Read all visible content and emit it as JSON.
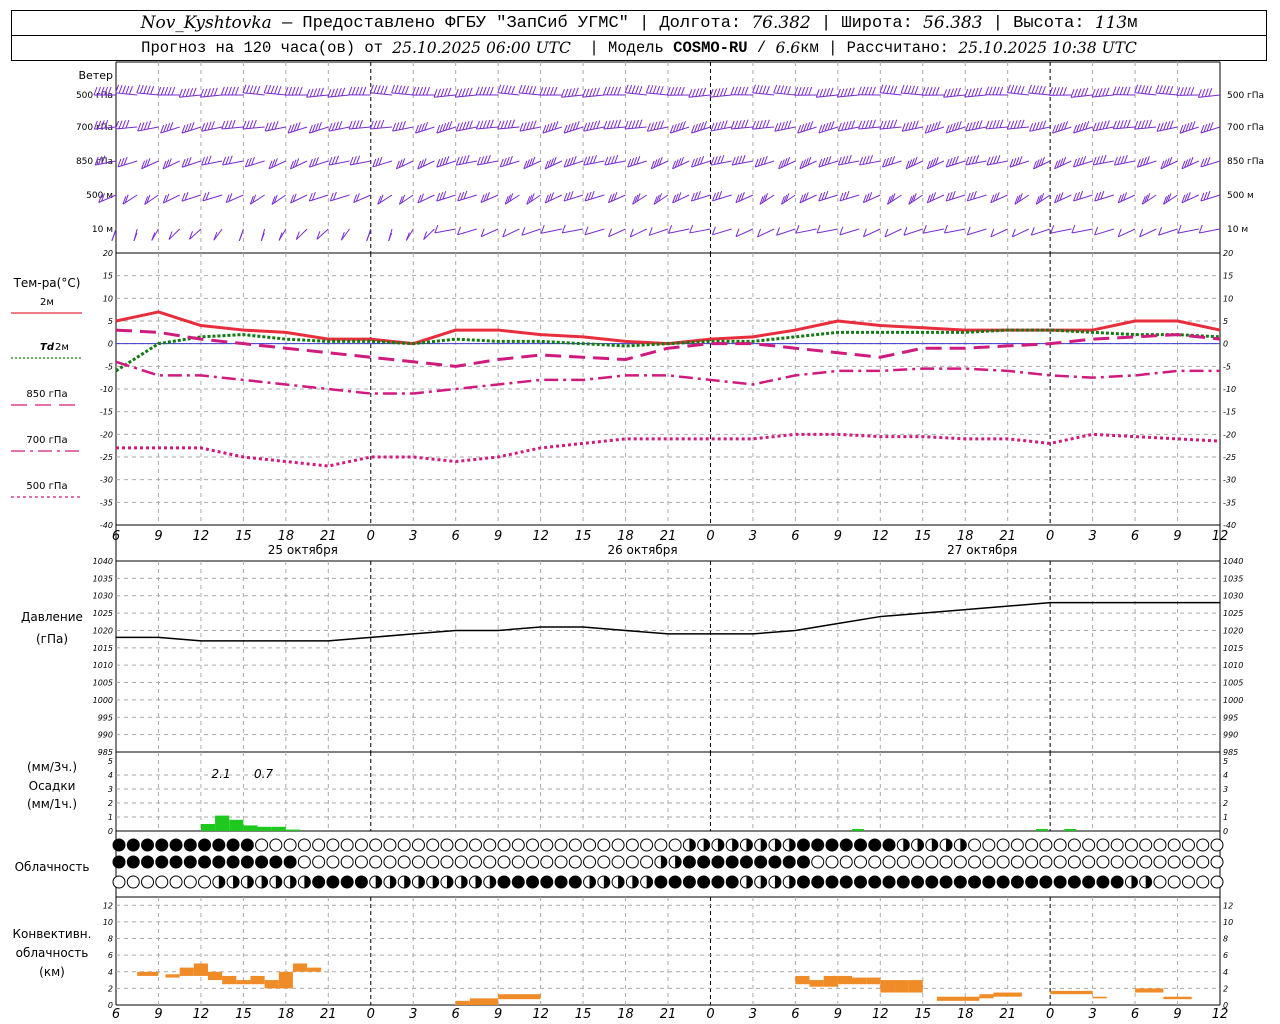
{
  "header": {
    "station": "Nov_Kyshtovka",
    "provider": "— Предоставлено ФГБУ \"ЗапСиб УГМС\"",
    "lon_label": "Долгота:",
    "lon_value": "76.382",
    "lat_label": "Широта:",
    "lat_value": "56.383",
    "alt_label": "Высота:",
    "alt_value": "113",
    "alt_unit": "м",
    "forecast_prefix": "Прогноз на 120 часа(ов) от",
    "forecast_start": "25.10.2025 06:00 UTC",
    "model_label": "Модель",
    "model_name": "COSMO-RU",
    "model_res": "6.6",
    "model_res_unit": "км",
    "calc_label": "Рассчитано:",
    "calc_time": "25.10.2025 10:38 UTC"
  },
  "panels": {
    "wind": {
      "title": "Ветер",
      "levels": [
        "500 гПа",
        "700 гПа",
        "850 гПа",
        "500 м",
        "10 м"
      ]
    },
    "temperature": {
      "title": "Тем-ра(°C)",
      "legend": [
        {
          "label": "2м",
          "color": "#e82e3c",
          "style": "solid"
        },
        {
          "label": "Td",
          "sub": "2м",
          "color": "#137a13",
          "style": "dotted"
        },
        {
          "label": "850 гПа",
          "color": "#d01a7e",
          "style": "dash"
        },
        {
          "label": "700 гПа",
          "color": "#d01a7e",
          "style": "dashdot"
        },
        {
          "label": "500 гПа",
          "color": "#d01a7e",
          "style": "dot"
        }
      ]
    },
    "pressure": {
      "title": "Давление",
      "unit": "(гПа)"
    },
    "precip": {
      "title_top": "(мм/3ч.)",
      "title": "Осадки",
      "title_bottom": "(мм/1ч.)"
    },
    "cloud": {
      "title": "Облачность"
    },
    "convective": {
      "title_1": "Конвективн.",
      "title_2": "облачность",
      "title_3": "(км)"
    }
  },
  "chart_data": [
    {
      "type": "line",
      "name": "temperature",
      "x_ticks": [
        "6",
        "9",
        "12",
        "15",
        "18",
        "21",
        "0",
        "3",
        "6",
        "9",
        "12",
        "15",
        "18",
        "21",
        "0",
        "3",
        "6",
        "9",
        "12",
        "15",
        "18",
        "21",
        "0",
        "3",
        "6",
        "9",
        "12"
      ],
      "day_labels": [
        "25 октября",
        "26 октября",
        "27 октября"
      ],
      "ylim": [
        -40,
        20
      ],
      "yticks": [
        -40,
        -35,
        -30,
        -25,
        -20,
        -15,
        -10,
        -5,
        0,
        5,
        10,
        15,
        20
      ],
      "x_hours": [
        0,
        3,
        6,
        9,
        12,
        15,
        18,
        21,
        24,
        27,
        30,
        33,
        36,
        39,
        42,
        45,
        48,
        51,
        54,
        57,
        60,
        63,
        66,
        69,
        72,
        75,
        78
      ],
      "series": [
        {
          "name": "2м",
          "values": [
            5,
            7,
            4,
            3,
            2.5,
            1,
            1,
            0,
            3,
            3,
            2,
            1.5,
            0.5,
            0,
            1,
            1.5,
            3,
            5,
            4,
            3.5,
            3,
            3,
            3,
            3,
            5,
            5,
            3
          ]
        },
        {
          "name": "Td 2м",
          "values": [
            -6,
            0,
            1.5,
            2,
            1,
            0.5,
            0.5,
            0,
            1,
            0.5,
            0.5,
            0,
            -0.5,
            0,
            0.5,
            0.5,
            1.5,
            2.5,
            2.5,
            2.5,
            2.5,
            3,
            3,
            2.5,
            2,
            2,
            1.5
          ]
        },
        {
          "name": "850 гПа",
          "values": [
            3,
            2.5,
            1,
            0,
            -1,
            -2,
            -3,
            -4,
            -5,
            -3.5,
            -2.5,
            -3,
            -3.5,
            -1,
            0,
            0,
            -1,
            -2,
            -3,
            -1,
            -1,
            -0.5,
            0,
            1,
            1.5,
            2,
            1
          ]
        },
        {
          "name": "700 гПа",
          "values": [
            -4,
            -7,
            -7,
            -8,
            -9,
            -10,
            -11,
            -11,
            -10,
            -9,
            -8,
            -8,
            -7,
            -7,
            -8,
            -9,
            -7,
            -6,
            -6,
            -5.5,
            -5.5,
            -6,
            -7,
            -7.5,
            -7,
            -6,
            -6
          ]
        },
        {
          "name": "500 гПа",
          "values": [
            -23,
            -23,
            -23,
            -25,
            -26,
            -27,
            -25,
            -25,
            -26,
            -25,
            -23,
            -22,
            -21,
            -21,
            -21,
            -21,
            -20,
            -20,
            -20.5,
            -20.5,
            -21,
            -21,
            -22,
            -20,
            -20.5,
            -21,
            -21.5
          ]
        }
      ]
    },
    {
      "type": "line",
      "name": "pressure",
      "ylim": [
        985,
        1040
      ],
      "yticks": [
        985,
        990,
        995,
        1000,
        1005,
        1010,
        1015,
        1020,
        1025,
        1030,
        1035,
        1040
      ],
      "x_hours": [
        0,
        3,
        6,
        9,
        12,
        15,
        18,
        21,
        24,
        27,
        30,
        33,
        36,
        39,
        42,
        45,
        48,
        51,
        54,
        57,
        60,
        63,
        66,
        69,
        72,
        75,
        78
      ],
      "values": [
        1018,
        1018,
        1017,
        1017,
        1017,
        1017,
        1018,
        1019,
        1020,
        1020,
        1021,
        1021,
        1020,
        1019,
        1019,
        1019,
        1020,
        1022,
        1024,
        1025,
        1026,
        1027,
        1028,
        1028,
        1028,
        1028,
        1028
      ]
    },
    {
      "type": "bar",
      "name": "precipitation",
      "ylim": [
        0,
        5
      ],
      "yticks": [
        0,
        1,
        2,
        3,
        4,
        5
      ],
      "x_hours": [
        6,
        7,
        8,
        9,
        10,
        11,
        12,
        13
      ],
      "values": [
        0.5,
        1.1,
        0.8,
        0.4,
        0.3,
        0.3,
        0.1,
        0
      ],
      "color": "#1ec81e",
      "annotations": [
        {
          "x_hour": 7,
          "text": "2.1"
        },
        {
          "x_hour": 10,
          "text": "0.7"
        }
      ]
    },
    {
      "type": "table",
      "name": "cloudiness",
      "rows": [
        {
          "name": "upper",
          "segments": [
            [
              0,
              10,
              "full"
            ],
            [
              10,
              40,
              "empty"
            ],
            [
              40,
              48,
              "half"
            ],
            [
              48,
              55,
              "full"
            ],
            [
              55,
              60,
              "half"
            ],
            [
              60,
              78,
              "empty"
            ]
          ]
        },
        {
          "name": "middle",
          "segments": [
            [
              0,
              13,
              "full"
            ],
            [
              13,
              38,
              "empty"
            ],
            [
              38,
              40,
              "half"
            ],
            [
              40,
              49,
              "full"
            ],
            [
              49,
              78,
              "empty"
            ]
          ]
        },
        {
          "name": "lower",
          "segments": [
            [
              0,
              7,
              "empty"
            ],
            [
              7,
              14,
              "half"
            ],
            [
              14,
              18,
              "full"
            ],
            [
              18,
              27,
              "half"
            ],
            [
              27,
              33,
              "full"
            ],
            [
              33,
              38,
              "half"
            ],
            [
              38,
              44,
              "full"
            ],
            [
              44,
              48,
              "half"
            ],
            [
              48,
              71,
              "full"
            ],
            [
              71,
              73,
              "half"
            ],
            [
              73,
              78,
              "empty"
            ]
          ]
        }
      ]
    },
    {
      "type": "bar",
      "name": "convective",
      "ylim": [
        0,
        13
      ],
      "yticks": [
        0,
        2,
        4,
        6,
        8,
        10,
        12
      ],
      "bars": [
        [
          1.5,
          3,
          3.5,
          4
        ],
        [
          3.5,
          4.5,
          3.3,
          3.7
        ],
        [
          4.5,
          5.5,
          3.5,
          4.5
        ],
        [
          5.5,
          6.5,
          3.5,
          5
        ],
        [
          6.5,
          7.5,
          3,
          4
        ],
        [
          7.5,
          8.5,
          2.5,
          3.5
        ],
        [
          8.5,
          9.5,
          2.5,
          3
        ],
        [
          9.5,
          10.5,
          2.5,
          3.5
        ],
        [
          10.5,
          11.5,
          2,
          3
        ],
        [
          11.5,
          12.5,
          2,
          4
        ],
        [
          12.5,
          13.5,
          4,
          5
        ],
        [
          13.5,
          14.5,
          4,
          4.5
        ],
        [
          24,
          25,
          0,
          0.5
        ],
        [
          25,
          27,
          0,
          0.8
        ],
        [
          27,
          30,
          0.7,
          1.3
        ],
        [
          48,
          49,
          2.5,
          3.5
        ],
        [
          49,
          50,
          2.2,
          3
        ],
        [
          50,
          51,
          2.2,
          3.5
        ],
        [
          51,
          52,
          2.5,
          3.5
        ],
        [
          52,
          53,
          2.5,
          3.3
        ],
        [
          53,
          54,
          2.5,
          3.3
        ],
        [
          54,
          55,
          1.5,
          3
        ],
        [
          55,
          56,
          1.5,
          3
        ],
        [
          56,
          57,
          1.5,
          3
        ],
        [
          58,
          61,
          0.5,
          1
        ],
        [
          61,
          62,
          0.8,
          1.3
        ],
        [
          62,
          64,
          1,
          1.5
        ],
        [
          66,
          69,
          1.3,
          1.7
        ],
        [
          69,
          70,
          0.8,
          1
        ],
        [
          72,
          74,
          1.5,
          2
        ],
        [
          74,
          76,
          0.7,
          1
        ]
      ],
      "color": "#f08c28"
    },
    {
      "type": "scatter",
      "name": "wind",
      "levels": [
        "500 гПа",
        "700 гПа",
        "850 гПа",
        "500 м",
        "10 м"
      ],
      "x_hours": [
        0,
        3,
        6,
        9,
        12,
        15,
        18,
        21,
        24,
        27,
        30,
        33,
        36,
        39,
        42,
        45,
        48,
        51,
        54,
        57,
        60,
        63,
        66,
        69,
        72,
        75,
        78
      ],
      "speed_ms": [
        [
          25,
          25,
          25,
          25,
          25,
          25,
          25,
          25,
          25,
          25,
          25,
          25,
          25,
          25,
          25,
          25,
          25,
          25,
          25,
          25,
          25,
          25,
          25,
          25,
          25,
          25,
          20
        ],
        [
          20,
          20,
          20,
          20,
          20,
          20,
          20,
          20,
          25,
          25,
          25,
          25,
          25,
          25,
          25,
          25,
          25,
          25,
          25,
          25,
          25,
          25,
          25,
          25,
          25,
          25,
          20
        ],
        [
          15,
          15,
          15,
          15,
          15,
          15,
          15,
          15,
          20,
          20,
          20,
          20,
          20,
          20,
          20,
          20,
          20,
          20,
          20,
          20,
          20,
          20,
          20,
          20,
          20,
          20,
          15
        ],
        [
          10,
          10,
          10,
          10,
          10,
          10,
          10,
          10,
          15,
          15,
          15,
          15,
          15,
          15,
          15,
          15,
          15,
          15,
          15,
          15,
          15,
          15,
          15,
          15,
          15,
          15,
          15
        ],
        [
          3,
          3,
          3,
          3,
          3,
          3,
          3,
          3,
          5,
          5,
          5,
          5,
          5,
          5,
          5,
          5,
          5,
          5,
          5,
          5,
          5,
          5,
          5,
          5,
          5,
          5,
          5
        ]
      ],
      "direction_deg": [
        [
          270,
          270,
          270,
          270,
          270,
          270,
          270,
          270,
          270,
          270,
          270,
          270,
          270,
          270,
          270,
          270,
          270,
          270,
          270,
          270,
          270,
          270,
          270,
          270,
          270,
          270,
          270
        ],
        [
          250,
          250,
          250,
          250,
          250,
          250,
          250,
          250,
          250,
          250,
          250,
          250,
          250,
          250,
          250,
          250,
          250,
          250,
          250,
          250,
          250,
          250,
          250,
          250,
          250,
          250,
          250
        ],
        [
          240,
          240,
          240,
          240,
          240,
          240,
          240,
          240,
          240,
          240,
          240,
          240,
          240,
          240,
          240,
          240,
          240,
          240,
          240,
          240,
          240,
          240,
          240,
          240,
          240,
          240,
          240
        ],
        [
          230,
          230,
          230,
          230,
          230,
          230,
          230,
          230,
          230,
          230,
          230,
          230,
          230,
          230,
          230,
          230,
          230,
          230,
          230,
          230,
          230,
          230,
          230,
          230,
          230,
          230,
          230
        ],
        [
          200,
          200,
          200,
          200,
          200,
          200,
          200,
          200,
          240,
          240,
          240,
          240,
          240,
          240,
          240,
          240,
          240,
          240,
          240,
          240,
          240,
          240,
          240,
          240,
          240,
          240,
          240
        ]
      ],
      "color": "#7a2bd0"
    }
  ]
}
